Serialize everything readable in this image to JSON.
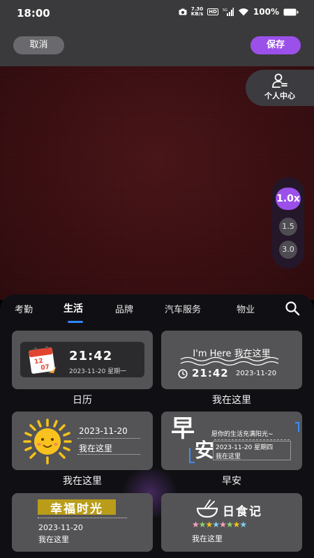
{
  "status_bar": {
    "time": "18:00",
    "speed_value": "7.30",
    "speed_unit": "KB/s",
    "hd_label": "HD",
    "network": "5G",
    "battery": "100%"
  },
  "top_bar": {
    "cancel_label": "取消",
    "save_label": "保存"
  },
  "profile": {
    "label": "个人中心"
  },
  "zoom": {
    "options": [
      "1.0x",
      "1.5",
      "3.0"
    ],
    "selected": "1.0x"
  },
  "tabs": {
    "items": [
      "考勤",
      "生活",
      "品牌",
      "汽车服务",
      "物业"
    ],
    "active": "生活"
  },
  "cards": {
    "calendar": {
      "label": "日历",
      "icon_month": "12",
      "icon_day": "07",
      "time": "21:42",
      "date": "2023-11-20  星期一"
    },
    "here_banner": {
      "label": "我在这里",
      "title": "I'm Here 我在这里",
      "time": "21:42",
      "date": "2023-11-20"
    },
    "sun": {
      "label": "我在这里",
      "date": "2023-11-20",
      "text": "我在这里"
    },
    "morning": {
      "label": "早安",
      "big1": "早",
      "big2": "安",
      "wish": "愿你的生活充满阳光~",
      "date": "2023-11-20  星期四",
      "text": "我在这里"
    },
    "happy": {
      "title": "幸福时光",
      "date": "2023-11-20",
      "text": "我在这里"
    },
    "food": {
      "title": "日食记",
      "stars": "★★★★★★★★",
      "text": "我在这里"
    }
  },
  "colors": {
    "accent": "#9c50ea",
    "tab_indicator": "#2f86ff",
    "preview_bg": "#3a0e11",
    "card_bg": "#545456"
  }
}
